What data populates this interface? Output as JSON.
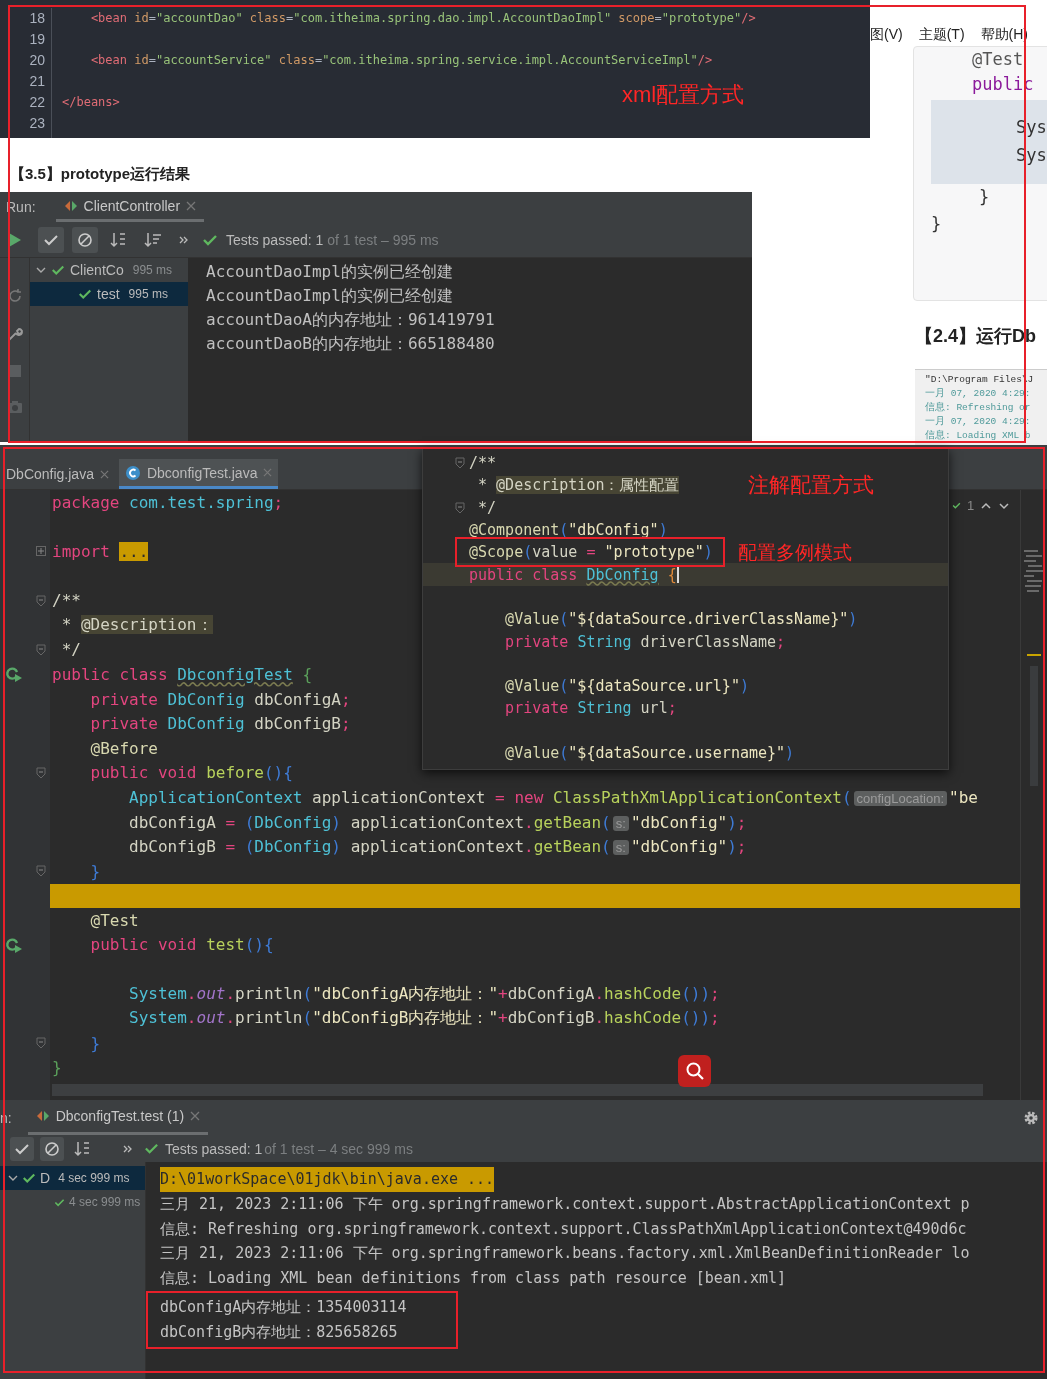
{
  "article": {
    "xml_code": {
      "annotation": "xml配置方式",
      "lines": [
        {
          "number": "18",
          "tokens": [
            {
              "text": "    <bean ",
              "kind": "tag"
            },
            {
              "text": "id",
              "kind": "attr"
            },
            {
              "text": "=",
              "kind": "p"
            },
            {
              "text": "\"accountDao\"",
              "kind": "str"
            },
            {
              "text": " class",
              "kind": "attr"
            },
            {
              "text": "=",
              "kind": "p"
            },
            {
              "text": "\"com.itheima.spring.dao.impl.AccountDaoImpl\"",
              "kind": "str"
            },
            {
              "text": " scope",
              "kind": "attr"
            },
            {
              "text": "=",
              "kind": "p"
            },
            {
              "text": "\"prototype\"",
              "kind": "str"
            },
            {
              "text": "/>",
              "kind": "tag"
            }
          ]
        },
        {
          "number": "19"
        },
        {
          "number": "20",
          "tokens": [
            {
              "text": "    <bean ",
              "kind": "tag"
            },
            {
              "text": "id",
              "kind": "attr"
            },
            {
              "text": "=",
              "kind": "p"
            },
            {
              "text": "\"accountService\"",
              "kind": "str"
            },
            {
              "text": " class",
              "kind": "attr"
            },
            {
              "text": "=",
              "kind": "p"
            },
            {
              "text": "\"com.itheima.spring.service.impl.AccountServiceImpl\"",
              "kind": "str"
            },
            {
              "text": "/>",
              "kind": "tag"
            }
          ]
        },
        {
          "number": "21"
        },
        {
          "number": "22",
          "tokens": [
            {
              "text": "</beans>",
              "kind": "tag"
            }
          ]
        },
        {
          "number": "23"
        }
      ]
    },
    "heading": "【3.5】prototype运行结果",
    "run_panel": {
      "label": "Run:",
      "tab": "ClientController",
      "status": {
        "passed": "Tests passed: 1",
        "detail": "of 1 test – 995 ms"
      },
      "tree": [
        {
          "label": "ClientCo",
          "time": "995 ms",
          "expanded": true,
          "selected": false,
          "children": [
            {
              "label": "test",
              "time": "995 ms",
              "selected": true
            }
          ]
        }
      ],
      "output": [
        "AccountDaoImpl的实例已经创建",
        "AccountDaoImpl的实例已经创建",
        "accountDaoA的内存地址：961419791",
        "accountDaoB的内存地址：665188480"
      ]
    }
  },
  "side_page": {
    "menu": [
      "图(V)",
      "主题(T)",
      "帮助(H)"
    ],
    "code": {
      "head": [
        {
          "text": "@Test",
          "kind": "ann"
        },
        {
          "text": "public",
          "kind": "kw"
        }
      ],
      "block": [
        "Sys",
        "Sys"
      ],
      "tail": [
        "}",
        "}"
      ]
    },
    "heading": "【2.4】运行Db",
    "console": [
      "\"D:\\Program Files\\J",
      "一月 07, 2020 4:29:",
      "信息: Refreshing or",
      "一月 07, 2020 4:29:",
      "信息: Loading XML b"
    ]
  },
  "ide": {
    "tabs": [
      {
        "label": "DbConfig.java",
        "selected": false
      },
      {
        "label": "DbconfigTest.java",
        "selected": true
      }
    ],
    "inspection": "1",
    "editor": {
      "lines": [
        {
          "kind": "code",
          "tokens": [
            {
              "text": "package",
              "kind": "kw"
            },
            {
              "text": " com.test.spring",
              "kind": "type"
            },
            {
              "text": ";",
              "kind": "kw"
            }
          ]
        },
        {
          "kind": "code"
        },
        {
          "kind": "code",
          "marker": {
            "kind": "expand"
          },
          "tokens": [
            {
              "text": "import ",
              "kind": "kw"
            },
            {
              "text": "...",
              "kind": "fold"
            }
          ]
        },
        {
          "kind": "code"
        },
        {
          "kind": "code",
          "marker": {
            "kind": "fold"
          },
          "tokens": [
            {
              "text": "/**",
              "kind": "doc"
            }
          ]
        },
        {
          "kind": "code",
          "tokens": [
            {
              "text": " * ",
              "kind": "doc"
            },
            {
              "text": "@Description：",
              "kind": "tag"
            }
          ]
        },
        {
          "kind": "code",
          "marker": {
            "kind": "fold"
          },
          "tokens": [
            {
              "text": " */",
              "kind": "doc"
            }
          ]
        },
        {
          "kind": "code",
          "marker": {
            "kind": "run"
          },
          "tokens": [
            {
              "text": "public class ",
              "kind": "kw"
            },
            {
              "text": "DbconfigTest",
              "kind": "cls"
            },
            {
              "text": " {",
              "kind": "brace"
            }
          ]
        },
        {
          "kind": "code",
          "tokens": [
            {
              "text": "    private ",
              "kind": "kw"
            },
            {
              "text": "DbConfig",
              "kind": "type"
            },
            {
              "text": " dbConfigA",
              "kind": "p"
            },
            {
              "text": ";",
              "kind": "kw"
            }
          ]
        },
        {
          "kind": "code",
          "tokens": [
            {
              "text": "    private ",
              "kind": "kw"
            },
            {
              "text": "DbConfig",
              "kind": "type"
            },
            {
              "text": " dbConfigB",
              "kind": "p"
            },
            {
              "text": ";",
              "kind": "kw"
            }
          ]
        },
        {
          "kind": "code",
          "tokens": [
            {
              "text": "    @Before",
              "kind": "ann"
            }
          ]
        },
        {
          "kind": "code",
          "marker": {
            "kind": "fold"
          },
          "tokens": [
            {
              "text": "    public void ",
              "kind": "kw"
            },
            {
              "text": "before",
              "kind": "fn"
            },
            {
              "text": "(){",
              "kind": "paren"
            }
          ]
        },
        {
          "kind": "code",
          "tokens": [
            {
              "text": "        ApplicationContext",
              "kind": "type"
            },
            {
              "text": " applicationContext ",
              "kind": "p"
            },
            {
              "text": "=",
              "kind": "kw"
            },
            {
              "text": " new ",
              "kind": "kw"
            },
            {
              "text": "ClassPathXmlApplicationContext",
              "kind": "fn"
            },
            {
              "text": "(",
              "kind": "paren"
            },
            {
              "text": "configLocation:",
              "kind": "hint"
            },
            {
              "text": "\"be",
              "kind": "str"
            }
          ]
        },
        {
          "kind": "code",
          "tokens": [
            {
              "text": "        dbConfigA ",
              "kind": "p"
            },
            {
              "text": "=",
              "kind": "kw"
            },
            {
              "text": " (",
              "kind": "paren"
            },
            {
              "text": "DbConfig",
              "kind": "type"
            },
            {
              "text": ")",
              "kind": "paren"
            },
            {
              "text": " applicationContext",
              "kind": "p"
            },
            {
              "text": ".",
              "kind": "kw"
            },
            {
              "text": "getBean",
              "kind": "fn"
            },
            {
              "text": "(",
              "kind": "paren"
            },
            {
              "text": "s:",
              "kind": "hint"
            },
            {
              "text": "\"dbConfig\"",
              "kind": "str"
            },
            {
              "text": ")",
              "kind": "paren"
            },
            {
              "text": ";",
              "kind": "kw"
            }
          ]
        },
        {
          "kind": "code",
          "tokens": [
            {
              "text": "        dbConfigB ",
              "kind": "p"
            },
            {
              "text": "=",
              "kind": "kw"
            },
            {
              "text": " (",
              "kind": "paren"
            },
            {
              "text": "DbConfig",
              "kind": "type"
            },
            {
              "text": ")",
              "kind": "paren"
            },
            {
              "text": " applicationContext",
              "kind": "p"
            },
            {
              "text": ".",
              "kind": "kw"
            },
            {
              "text": "getBean",
              "kind": "fn"
            },
            {
              "text": "(",
              "kind": "paren"
            },
            {
              "text": "s:",
              "kind": "hint"
            },
            {
              "text": "\"dbConfig\"",
              "kind": "str"
            },
            {
              "text": ")",
              "kind": "paren"
            },
            {
              "text": ";",
              "kind": "kw"
            }
          ]
        },
        {
          "kind": "code",
          "marker": {
            "kind": "fold"
          },
          "tokens": [
            {
              "text": "    }",
              "kind": "paren"
            }
          ]
        },
        {
          "kind": "band"
        },
        {
          "kind": "code",
          "tokens": [
            {
              "text": "    @Test",
              "kind": "ann"
            }
          ]
        },
        {
          "kind": "code",
          "marker": {
            "kind": "run"
          },
          "tokens": [
            {
              "text": "    public void ",
              "kind": "kw"
            },
            {
              "text": "test",
              "kind": "fn"
            },
            {
              "text": "(){",
              "kind": "paren"
            }
          ]
        },
        {
          "kind": "code"
        },
        {
          "kind": "code",
          "tokens": [
            {
              "text": "        System",
              "kind": "type"
            },
            {
              "text": ".",
              "kind": "kw"
            },
            {
              "text": "out",
              "kind": "field"
            },
            {
              "text": ".",
              "kind": "kw"
            },
            {
              "text": "println",
              "kind": "p"
            },
            {
              "text": "(",
              "kind": "paren"
            },
            {
              "text": "\"dbConfigA内存地址：\"",
              "kind": "str"
            },
            {
              "text": "+",
              "kind": "kw"
            },
            {
              "text": "dbConfigA",
              "kind": "p"
            },
            {
              "text": ".",
              "kind": "kw"
            },
            {
              "text": "hashCode",
              "kind": "fn"
            },
            {
              "text": "())",
              "kind": "paren"
            },
            {
              "text": ";",
              "kind": "kw"
            }
          ]
        },
        {
          "kind": "code",
          "tokens": [
            {
              "text": "        System",
              "kind": "type"
            },
            {
              "text": ".",
              "kind": "kw"
            },
            {
              "text": "out",
              "kind": "field"
            },
            {
              "text": ".",
              "kind": "kw"
            },
            {
              "text": "println",
              "kind": "p"
            },
            {
              "text": "(",
              "kind": "paren"
            },
            {
              "text": "\"dbConfigB内存地址：\"",
              "kind": "str"
            },
            {
              "text": "+",
              "kind": "kw"
            },
            {
              "text": "dbConfigB",
              "kind": "p"
            },
            {
              "text": ".",
              "kind": "kw"
            },
            {
              "text": "hashCode",
              "kind": "fn"
            },
            {
              "text": "())",
              "kind": "paren"
            },
            {
              "text": ";",
              "kind": "kw"
            }
          ]
        },
        {
          "kind": "code",
          "marker": {
            "kind": "fold"
          },
          "tokens": [
            {
              "text": "    }",
              "kind": "paren"
            }
          ]
        },
        {
          "kind": "code",
          "tokens": [
            {
              "text": "}",
              "kind": "brace"
            }
          ]
        }
      ]
    },
    "popup": {
      "annotations": [
        "注解配置方式",
        "配置多例模式"
      ],
      "lines": [
        {
          "kind": "code",
          "marker": {
            "kind": "fold"
          },
          "tokens": [
            {
              "text": "/**",
              "kind": "doc"
            }
          ]
        },
        {
          "kind": "code",
          "tokens": [
            {
              "text": " * ",
              "kind": "doc"
            },
            {
              "text": "@Description：属性配置",
              "kind": "tag"
            }
          ]
        },
        {
          "kind": "code",
          "marker": {
            "kind": "fold"
          },
          "tokens": [
            {
              "text": " */",
              "kind": "doc"
            }
          ]
        },
        {
          "kind": "code",
          "tokens": [
            {
              "text": "@Component",
              "kind": "ann"
            },
            {
              "text": "(",
              "kind": "paren"
            },
            {
              "text": "\"dbConfig\"",
              "kind": "str"
            },
            {
              "text": ")",
              "kind": "paren"
            }
          ]
        },
        {
          "kind": "boxed",
          "tokens": [
            {
              "text": "@Scope",
              "kind": "ann"
            },
            {
              "text": "(",
              "kind": "paren"
            },
            {
              "text": "value ",
              "kind": "p"
            },
            {
              "text": "=",
              "kind": "kw"
            },
            {
              "text": " \"prototype\"",
              "kind": "str"
            },
            {
              "text": ")",
              "kind": "paren"
            }
          ]
        },
        {
          "kind": "current",
          "tokens": [
            {
              "text": "public class ",
              "kind": "kw"
            },
            {
              "text": "DbConfig",
              "kind": "cls"
            },
            {
              "text": " {",
              "kind": "orange"
            }
          ]
        },
        {
          "kind": "code"
        },
        {
          "kind": "code",
          "tokens": [
            {
              "text": "    @Value",
              "kind": "ann"
            },
            {
              "text": "(",
              "kind": "paren"
            },
            {
              "text": "\"${dataSource.driverClassName}\"",
              "kind": "str"
            },
            {
              "text": ")",
              "kind": "paren"
            }
          ]
        },
        {
          "kind": "code",
          "tokens": [
            {
              "text": "    private ",
              "kind": "kw"
            },
            {
              "text": "String",
              "kind": "type"
            },
            {
              "text": " driverClassName",
              "kind": "p"
            },
            {
              "text": ";",
              "kind": "kw"
            }
          ]
        },
        {
          "kind": "code"
        },
        {
          "kind": "code",
          "tokens": [
            {
              "text": "    @Value",
              "kind": "ann"
            },
            {
              "text": "(",
              "kind": "paren"
            },
            {
              "text": "\"${dataSource.url}\"",
              "kind": "str"
            },
            {
              "text": ")",
              "kind": "paren"
            }
          ]
        },
        {
          "kind": "code",
          "tokens": [
            {
              "text": "    private ",
              "kind": "kw"
            },
            {
              "text": "String",
              "kind": "type"
            },
            {
              "text": " url",
              "kind": "p"
            },
            {
              "text": ";",
              "kind": "kw"
            }
          ]
        },
        {
          "kind": "code"
        },
        {
          "kind": "code",
          "tokens": [
            {
              "text": "    @Value",
              "kind": "ann"
            },
            {
              "text": "(",
              "kind": "paren"
            },
            {
              "text": "\"${dataSource.username}\"",
              "kind": "str"
            },
            {
              "text": ")",
              "kind": "paren"
            }
          ]
        }
      ]
    },
    "run_panel": {
      "label": "n:",
      "tab": "DbconfigTest.test (1)",
      "status": {
        "passed": "Tests passed: 1",
        "detail": "of 1 test – 4 sec 999 ms"
      },
      "tree": [
        {
          "label": "D",
          "time": "4 sec 999 ms",
          "expanded": true,
          "selected": true,
          "children": [
            {
              "time": "4 sec 999 ms",
              "selected": false
            }
          ]
        }
      ],
      "console": {
        "lines": [
          {
            "kind": "cmd",
            "text": "D:\\01workSpace\\01jdk\\bin\\java.exe ..."
          },
          {
            "kind": "log",
            "text": "三月 21, 2023 2:11:06 下午 org.springframework.context.support.AbstractApplicationContext p"
          },
          {
            "kind": "log",
            "text": "信息: Refreshing org.springframework.context.support.ClassPathXmlApplicationContext@490d6c"
          },
          {
            "kind": "log",
            "text": "三月 21, 2023 2:11:06 下午 org.springframework.beans.factory.xml.XmlBeanDefinitionReader lo"
          },
          {
            "kind": "log",
            "text": "信息: Loading XML bean definitions from class path resource [bean.xml]"
          }
        ],
        "boxed_lines": [
          "dbConfigA内存地址：1354003114",
          "dbConfigB内存地址：825658265"
        ]
      }
    }
  }
}
